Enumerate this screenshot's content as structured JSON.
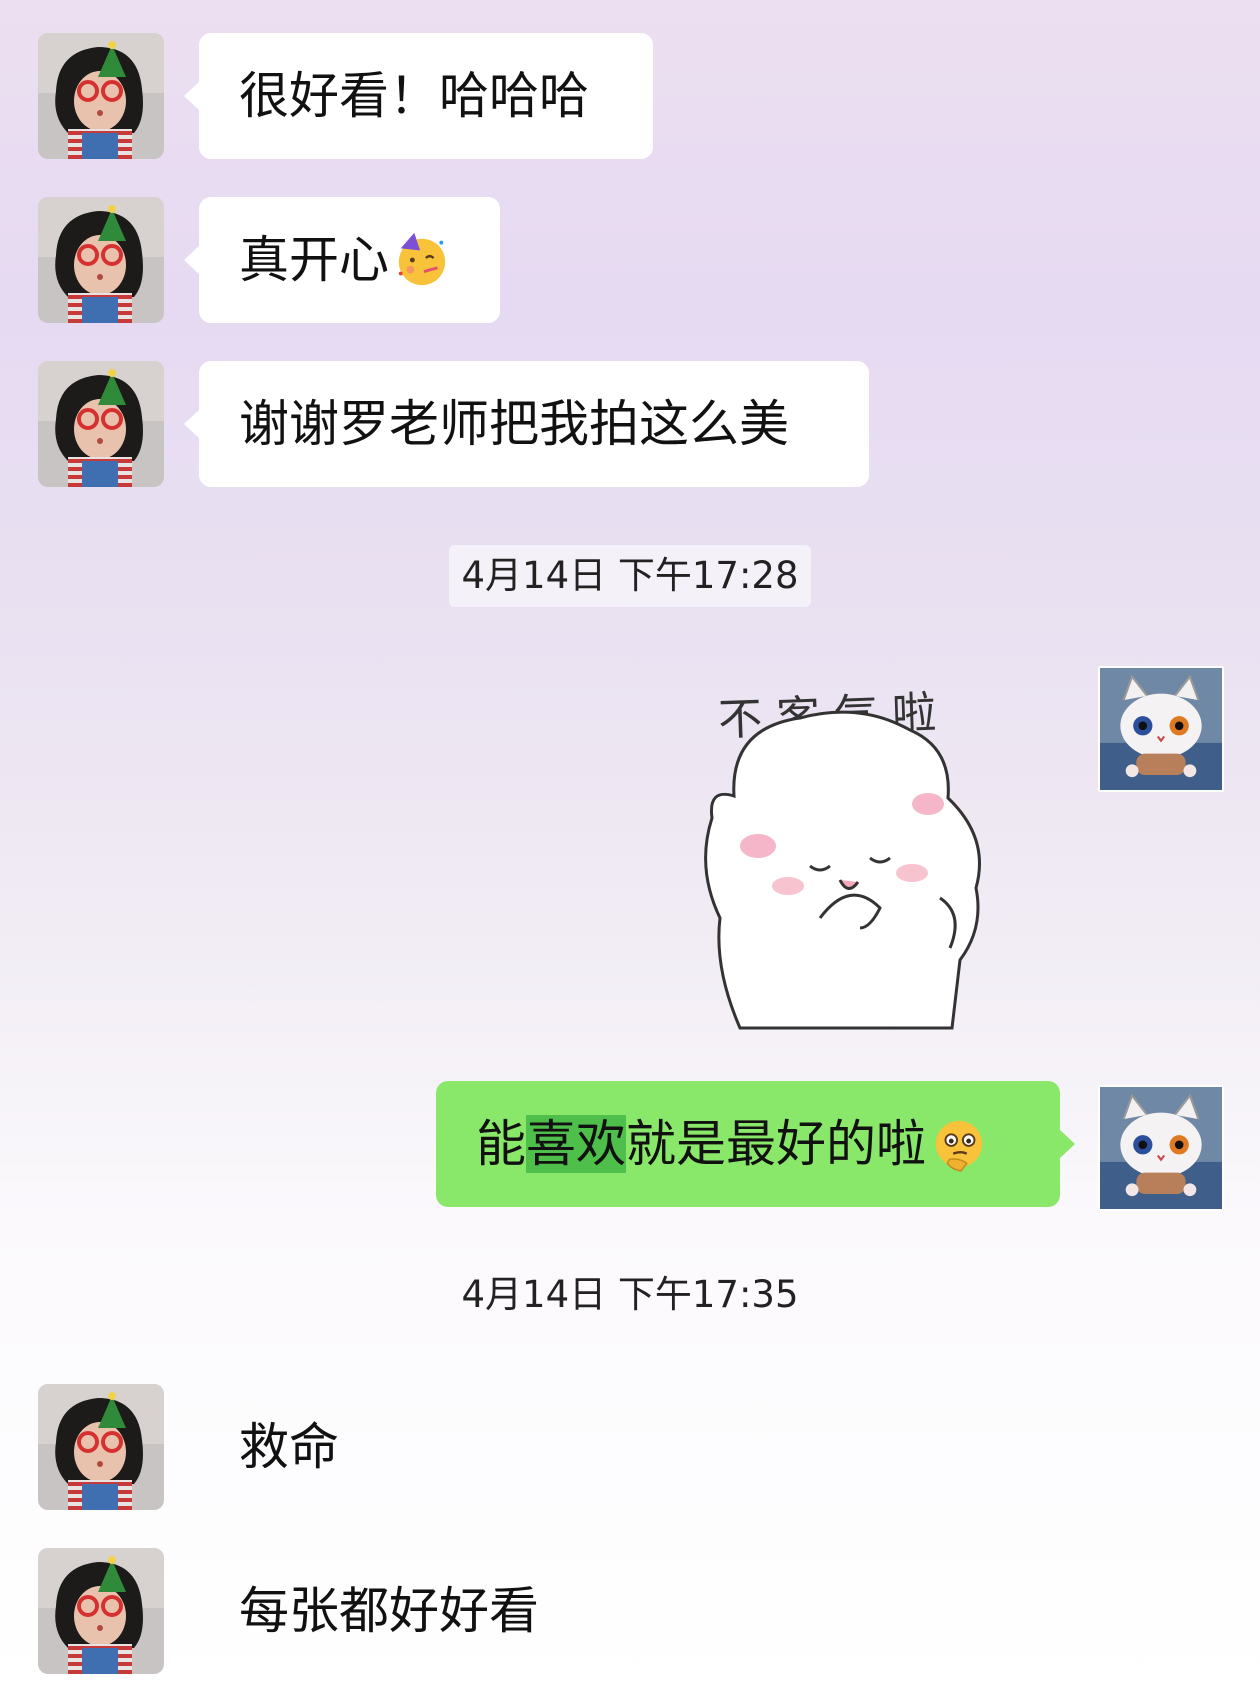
{
  "messages": {
    "m1": "很好看！哈哈哈",
    "m2": "真开心",
    "m3": "谢谢罗老师把我拍这么美",
    "m4_pre": "能",
    "m4_hl": "喜欢",
    "m4_post": "就是最好的啦",
    "m5": "救命",
    "m6": "每张都好好看"
  },
  "sticker": {
    "caption": "不客气啦"
  },
  "timestamps": {
    "t1": "4月14日 下午17:28",
    "t2": "4月14日 下午17:35"
  },
  "icons": {
    "party_face": "partying-face-emoji",
    "thinking_face": "thinking-face-emoji"
  },
  "colors": {
    "outgoing_bubble": "#89e86a",
    "incoming_bubble": "#ffffff"
  }
}
